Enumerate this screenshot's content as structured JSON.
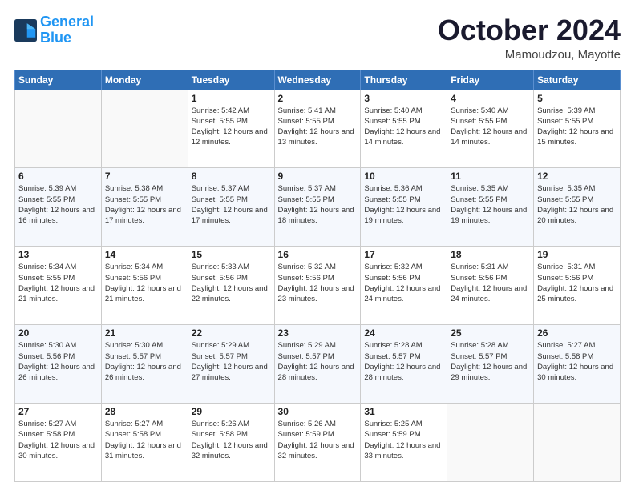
{
  "logo": {
    "line1": "General",
    "line2": "Blue"
  },
  "title": "October 2024",
  "location": "Mamoudzou, Mayotte",
  "weekdays": [
    "Sunday",
    "Monday",
    "Tuesday",
    "Wednesday",
    "Thursday",
    "Friday",
    "Saturday"
  ],
  "weeks": [
    [
      {
        "day": "",
        "sunrise": "",
        "sunset": "",
        "daylight": ""
      },
      {
        "day": "",
        "sunrise": "",
        "sunset": "",
        "daylight": ""
      },
      {
        "day": "1",
        "sunrise": "Sunrise: 5:42 AM",
        "sunset": "Sunset: 5:55 PM",
        "daylight": "Daylight: 12 hours and 12 minutes."
      },
      {
        "day": "2",
        "sunrise": "Sunrise: 5:41 AM",
        "sunset": "Sunset: 5:55 PM",
        "daylight": "Daylight: 12 hours and 13 minutes."
      },
      {
        "day": "3",
        "sunrise": "Sunrise: 5:40 AM",
        "sunset": "Sunset: 5:55 PM",
        "daylight": "Daylight: 12 hours and 14 minutes."
      },
      {
        "day": "4",
        "sunrise": "Sunrise: 5:40 AM",
        "sunset": "Sunset: 5:55 PM",
        "daylight": "Daylight: 12 hours and 14 minutes."
      },
      {
        "day": "5",
        "sunrise": "Sunrise: 5:39 AM",
        "sunset": "Sunset: 5:55 PM",
        "daylight": "Daylight: 12 hours and 15 minutes."
      }
    ],
    [
      {
        "day": "6",
        "sunrise": "Sunrise: 5:39 AM",
        "sunset": "Sunset: 5:55 PM",
        "daylight": "Daylight: 12 hours and 16 minutes."
      },
      {
        "day": "7",
        "sunrise": "Sunrise: 5:38 AM",
        "sunset": "Sunset: 5:55 PM",
        "daylight": "Daylight: 12 hours and 17 minutes."
      },
      {
        "day": "8",
        "sunrise": "Sunrise: 5:37 AM",
        "sunset": "Sunset: 5:55 PM",
        "daylight": "Daylight: 12 hours and 17 minutes."
      },
      {
        "day": "9",
        "sunrise": "Sunrise: 5:37 AM",
        "sunset": "Sunset: 5:55 PM",
        "daylight": "Daylight: 12 hours and 18 minutes."
      },
      {
        "day": "10",
        "sunrise": "Sunrise: 5:36 AM",
        "sunset": "Sunset: 5:55 PM",
        "daylight": "Daylight: 12 hours and 19 minutes."
      },
      {
        "day": "11",
        "sunrise": "Sunrise: 5:35 AM",
        "sunset": "Sunset: 5:55 PM",
        "daylight": "Daylight: 12 hours and 19 minutes."
      },
      {
        "day": "12",
        "sunrise": "Sunrise: 5:35 AM",
        "sunset": "Sunset: 5:55 PM",
        "daylight": "Daylight: 12 hours and 20 minutes."
      }
    ],
    [
      {
        "day": "13",
        "sunrise": "Sunrise: 5:34 AM",
        "sunset": "Sunset: 5:55 PM",
        "daylight": "Daylight: 12 hours and 21 minutes."
      },
      {
        "day": "14",
        "sunrise": "Sunrise: 5:34 AM",
        "sunset": "Sunset: 5:56 PM",
        "daylight": "Daylight: 12 hours and 21 minutes."
      },
      {
        "day": "15",
        "sunrise": "Sunrise: 5:33 AM",
        "sunset": "Sunset: 5:56 PM",
        "daylight": "Daylight: 12 hours and 22 minutes."
      },
      {
        "day": "16",
        "sunrise": "Sunrise: 5:32 AM",
        "sunset": "Sunset: 5:56 PM",
        "daylight": "Daylight: 12 hours and 23 minutes."
      },
      {
        "day": "17",
        "sunrise": "Sunrise: 5:32 AM",
        "sunset": "Sunset: 5:56 PM",
        "daylight": "Daylight: 12 hours and 24 minutes."
      },
      {
        "day": "18",
        "sunrise": "Sunrise: 5:31 AM",
        "sunset": "Sunset: 5:56 PM",
        "daylight": "Daylight: 12 hours and 24 minutes."
      },
      {
        "day": "19",
        "sunrise": "Sunrise: 5:31 AM",
        "sunset": "Sunset: 5:56 PM",
        "daylight": "Daylight: 12 hours and 25 minutes."
      }
    ],
    [
      {
        "day": "20",
        "sunrise": "Sunrise: 5:30 AM",
        "sunset": "Sunset: 5:56 PM",
        "daylight": "Daylight: 12 hours and 26 minutes."
      },
      {
        "day": "21",
        "sunrise": "Sunrise: 5:30 AM",
        "sunset": "Sunset: 5:57 PM",
        "daylight": "Daylight: 12 hours and 26 minutes."
      },
      {
        "day": "22",
        "sunrise": "Sunrise: 5:29 AM",
        "sunset": "Sunset: 5:57 PM",
        "daylight": "Daylight: 12 hours and 27 minutes."
      },
      {
        "day": "23",
        "sunrise": "Sunrise: 5:29 AM",
        "sunset": "Sunset: 5:57 PM",
        "daylight": "Daylight: 12 hours and 28 minutes."
      },
      {
        "day": "24",
        "sunrise": "Sunrise: 5:28 AM",
        "sunset": "Sunset: 5:57 PM",
        "daylight": "Daylight: 12 hours and 28 minutes."
      },
      {
        "day": "25",
        "sunrise": "Sunrise: 5:28 AM",
        "sunset": "Sunset: 5:57 PM",
        "daylight": "Daylight: 12 hours and 29 minutes."
      },
      {
        "day": "26",
        "sunrise": "Sunrise: 5:27 AM",
        "sunset": "Sunset: 5:58 PM",
        "daylight": "Daylight: 12 hours and 30 minutes."
      }
    ],
    [
      {
        "day": "27",
        "sunrise": "Sunrise: 5:27 AM",
        "sunset": "Sunset: 5:58 PM",
        "daylight": "Daylight: 12 hours and 30 minutes."
      },
      {
        "day": "28",
        "sunrise": "Sunrise: 5:27 AM",
        "sunset": "Sunset: 5:58 PM",
        "daylight": "Daylight: 12 hours and 31 minutes."
      },
      {
        "day": "29",
        "sunrise": "Sunrise: 5:26 AM",
        "sunset": "Sunset: 5:58 PM",
        "daylight": "Daylight: 12 hours and 32 minutes."
      },
      {
        "day": "30",
        "sunrise": "Sunrise: 5:26 AM",
        "sunset": "Sunset: 5:59 PM",
        "daylight": "Daylight: 12 hours and 32 minutes."
      },
      {
        "day": "31",
        "sunrise": "Sunrise: 5:25 AM",
        "sunset": "Sunset: 5:59 PM",
        "daylight": "Daylight: 12 hours and 33 minutes."
      },
      {
        "day": "",
        "sunrise": "",
        "sunset": "",
        "daylight": ""
      },
      {
        "day": "",
        "sunrise": "",
        "sunset": "",
        "daylight": ""
      }
    ]
  ]
}
